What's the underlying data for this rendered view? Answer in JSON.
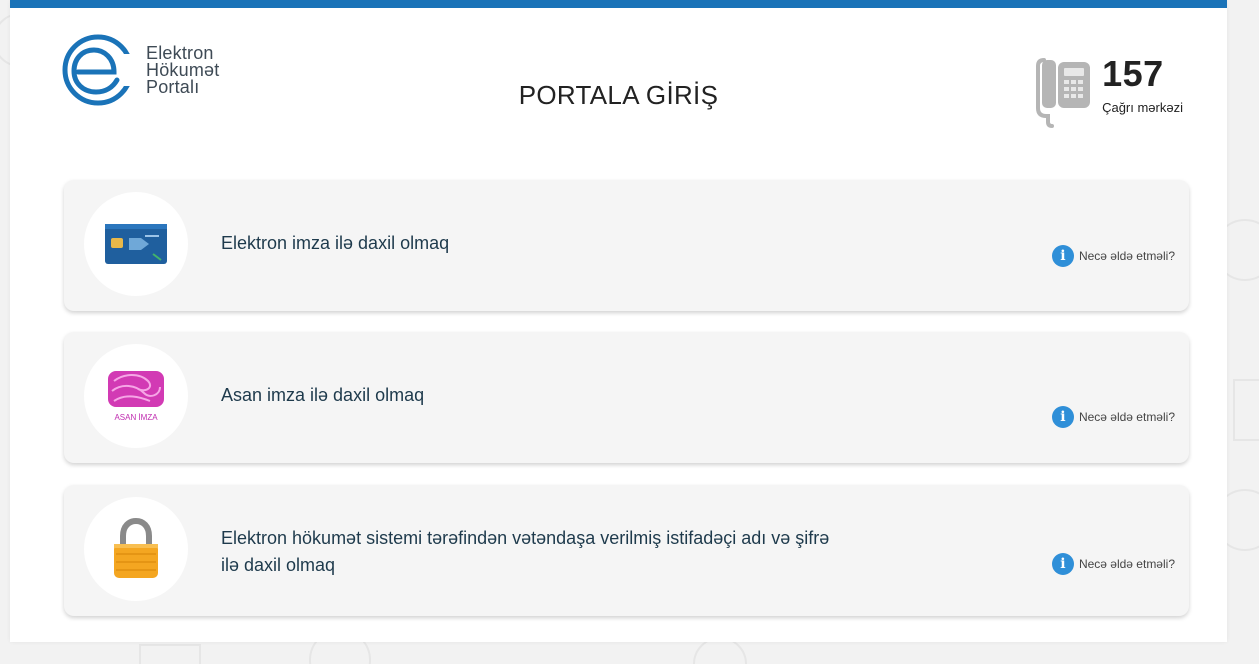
{
  "logo": {
    "line1": "Elektron",
    "line2": "Hökumət",
    "line3": "Portalı"
  },
  "page_title": "PORTALA GİRİŞ",
  "call_center": {
    "number": "157",
    "label": "Çağrı mərkəzi"
  },
  "login_options": [
    {
      "label": "Elektron imza ilə daxil olmaq",
      "help": "Necə əldə etməli?",
      "icon": "e-signature-card-icon"
    },
    {
      "label": "Asan imza ilə daxil olmaq",
      "help": "Necə əldə etməli?",
      "icon": "asan-imza-icon",
      "icon_caption": "ASAN İMZA"
    },
    {
      "label_line1": "Elektron hökumət sistemi tərəfindən vətəndaşa verilmiş istifadəçi adı və şifrə",
      "label_line2": "ilə daxil olmaq",
      "help": "Necə əldə etməli?",
      "icon": "padlock-icon"
    }
  ],
  "colors": {
    "accent": "#1a73b8",
    "card_bg": "#f5f5f5",
    "info_icon": "#2f8fd8",
    "padlock": "#f4a621",
    "asan_pink": "#c02bb0"
  }
}
